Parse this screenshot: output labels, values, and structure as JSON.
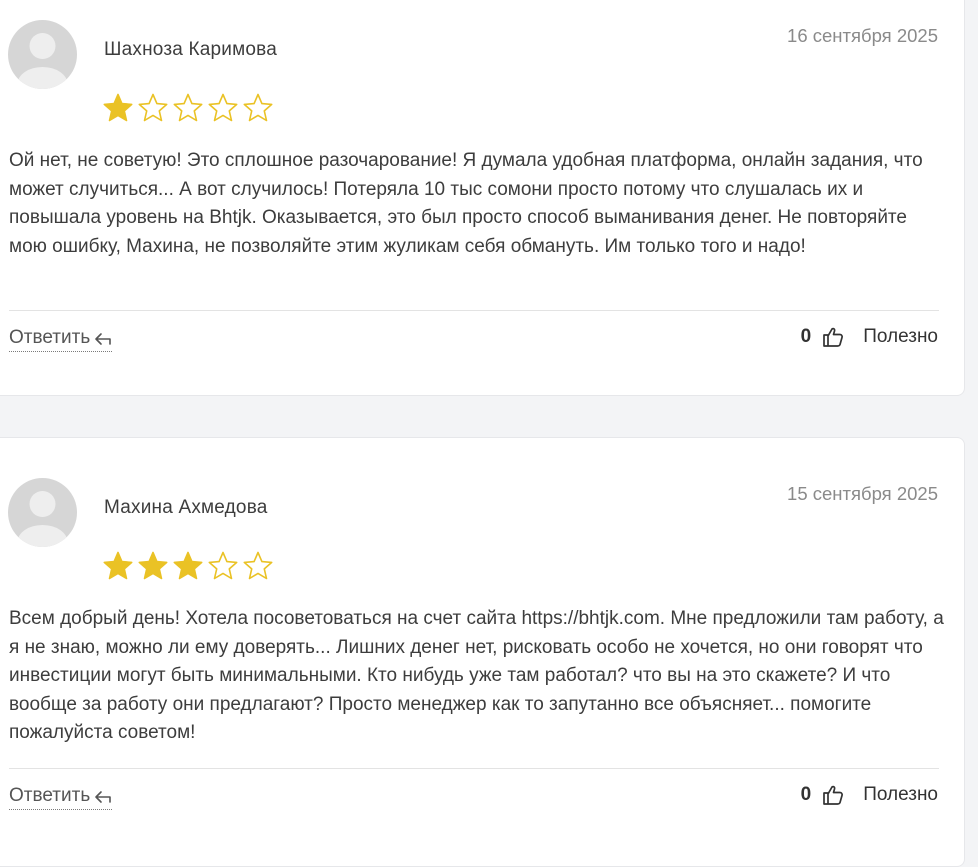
{
  "colors": {
    "star_filled": "#eac225",
    "star_outline": "#eac225",
    "text": "#3d3d3d",
    "muted": "#8a8a8a"
  },
  "reviews": [
    {
      "author": "Шахноза Каримова",
      "date": "16 сентября 2025",
      "rating": 1,
      "max_rating": 5,
      "text": "Ой нет, не советую! Это сплошное разочарование! Я думала удобная платформа, онлайн задания, что может случиться... А вот случилось! Потеряла 10 тыс сомони просто потому что слушалась их и повышала уровень на Bhtjk. Оказывается, это был просто способ выманивания денег. Не повторяйте мою ошибку, Махина, не позволяйте этим жуликам себя обмануть. Им только того и надо!",
      "reply_label": "Ответить",
      "helpful_count": "0",
      "helpful_label": "Полезно",
      "avatar_icon": "user-avatar-icon"
    },
    {
      "author": "Махина Ахмедова",
      "date": "15 сентября 2025",
      "rating": 3,
      "max_rating": 5,
      "text": "Всем добрый день! Хотела посоветоваться на счет сайта https://bhtjk.com. Мне предложили там работу, а я не знаю, можно ли ему доверять... Лишних денег нет, рисковать особо не хочется, но они говорят что инвестиции могут быть минимальными. Кто нибудь уже там работал? что вы на это скажете? И что вообще за работу они предлагают? Просто менеджер как то запутанно все объясняет... помогите пожалуйста советом!",
      "reply_label": "Ответить",
      "helpful_count": "0",
      "helpful_label": "Полезно",
      "avatar_icon": "user-avatar-icon"
    }
  ]
}
